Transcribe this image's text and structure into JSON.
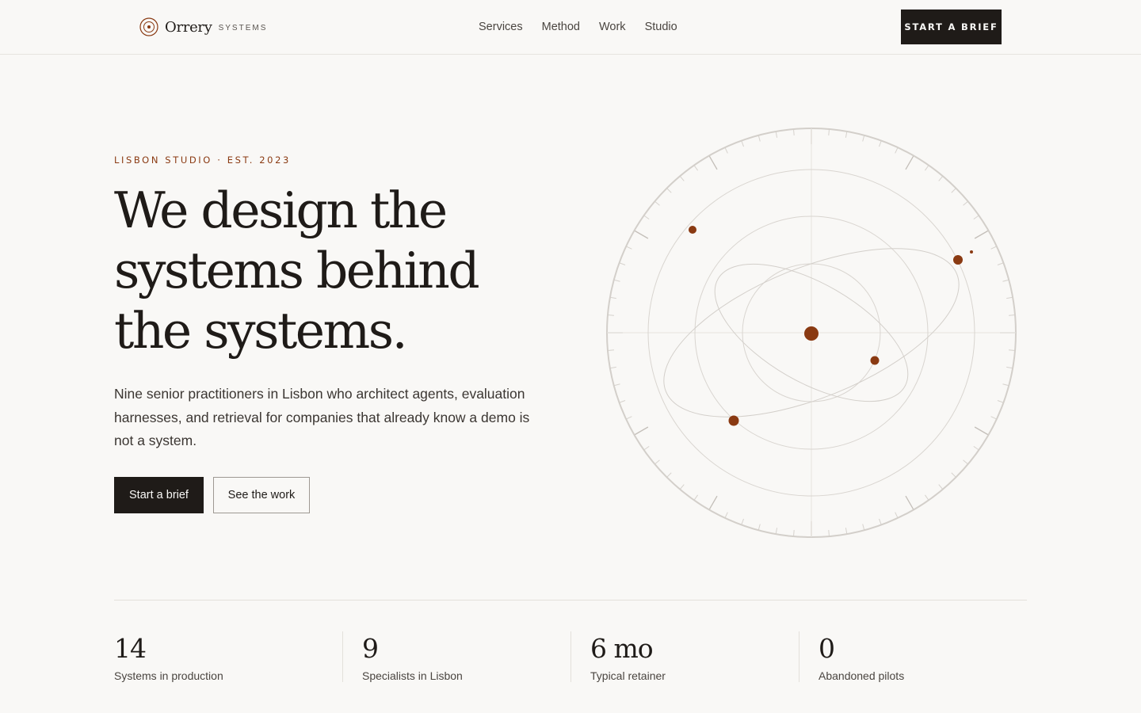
{
  "header": {
    "brand": "Orrery",
    "brand_sub": "SYSTEMS",
    "nav": [
      "Services",
      "Method",
      "Work",
      "Studio"
    ],
    "cta": "START A BRIEF"
  },
  "hero": {
    "eyebrow": "LISBON STUDIO · EST. 2023",
    "title_lines": [
      "We design the",
      "systems behind",
      "the systems."
    ],
    "copy": "Nine senior practitioners in Lisbon who architect agents, evaluation harnesses, and retrieval for companies that already know a demo is not a system.",
    "primary_button": "Start a brief",
    "secondary_button": "See the work"
  },
  "orrery_icon": "orrery-diagram",
  "colors": {
    "accent": "#8a3a12",
    "ink": "#1f1b18",
    "background": "#f9f8f6"
  },
  "stats": [
    {
      "value": "14",
      "label": "Systems in production"
    },
    {
      "value": "9",
      "label": "Specialists in Lisbon"
    },
    {
      "value": "6 mo",
      "label": "Typical retainer"
    },
    {
      "value": "0",
      "label": "Abandoned pilots"
    }
  ]
}
